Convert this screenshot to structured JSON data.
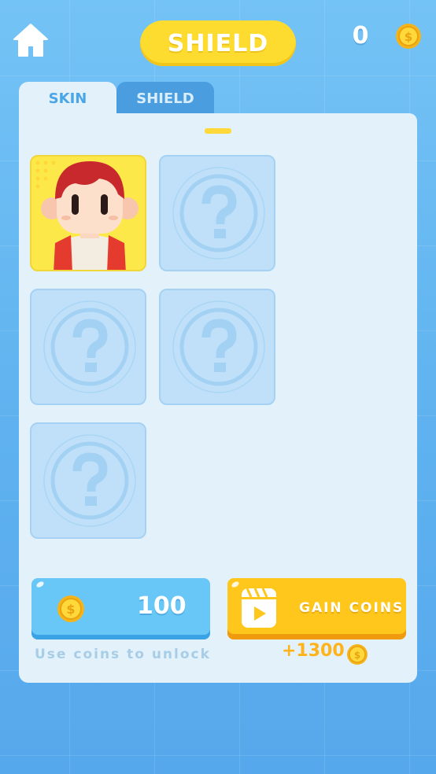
{
  "header": {
    "home_icon": "home-icon",
    "title": "SHIELD",
    "coin_count": "0",
    "coin_icon": "coin-icon"
  },
  "tabs": [
    {
      "label": "SKIN",
      "active": true
    },
    {
      "label": "SHIELD",
      "active": false
    }
  ],
  "pagination": {
    "pages": 1,
    "current": 1
  },
  "slots": [
    {
      "state": "unlocked",
      "icon": "character-avatar"
    },
    {
      "state": "locked",
      "icon": "question-mark-icon"
    },
    {
      "state": "locked",
      "icon": "question-mark-icon"
    },
    {
      "state": "locked",
      "icon": "question-mark-icon"
    },
    {
      "state": "locked",
      "icon": "question-mark-icon"
    }
  ],
  "unlock": {
    "price": "100",
    "hint": "Use coins to unlock"
  },
  "gain": {
    "label": "GAIN COINS",
    "reward": "+1300"
  },
  "colors": {
    "background": "#64b7f2",
    "title_pill": "#fddc2f",
    "panel": "#e3f1fb",
    "unlock_button": "#68c7f7",
    "gain_button": "#ffc61c",
    "reward_text": "#ffb31a"
  }
}
